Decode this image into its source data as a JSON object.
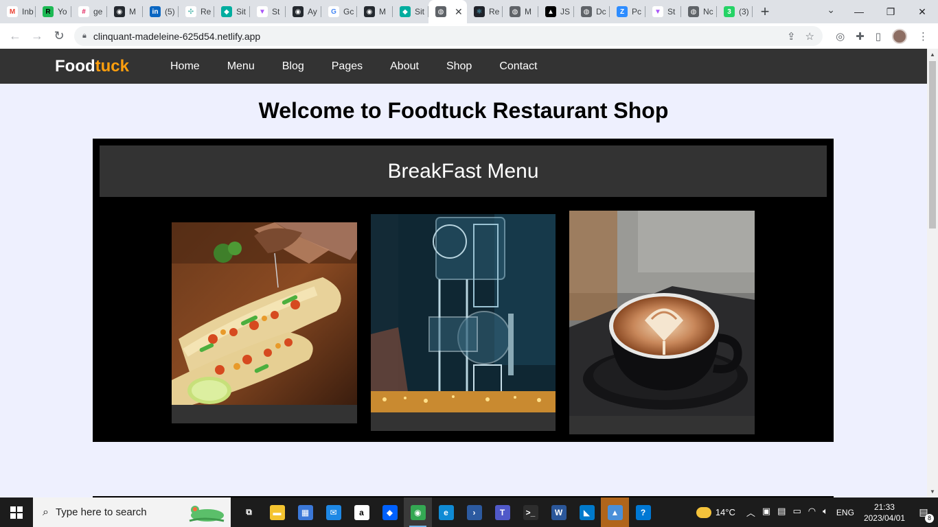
{
  "browser": {
    "tabs": [
      {
        "label": "Inb",
        "color": "#ffffff",
        "glyph": "M",
        "glyph_color": "#ea4335"
      },
      {
        "label": "Yo",
        "color": "#1db954",
        "glyph": "R",
        "glyph_color": "#000000"
      },
      {
        "label": "ge",
        "color": "#ffffff",
        "glyph": "#",
        "glyph_color": "#e01e5a"
      },
      {
        "label": "M",
        "color": "#24292f",
        "glyph": "◉",
        "glyph_color": "#ffffff"
      },
      {
        "label": "(5)",
        "color": "#0a66c2",
        "glyph": "in",
        "glyph_color": "#ffffff"
      },
      {
        "label": "Re",
        "color": "#ffffff",
        "glyph": "✣",
        "glyph_color": "#4db6ac"
      },
      {
        "label": "Sit",
        "color": "#00ad9f",
        "glyph": "◆",
        "glyph_color": "#ffffff"
      },
      {
        "label": "St",
        "color": "#ffffff",
        "glyph": "▼",
        "glyph_color": "#a855f7"
      },
      {
        "label": "Ay",
        "color": "#24292f",
        "glyph": "◉",
        "glyph_color": "#ffffff"
      },
      {
        "label": "Gc",
        "color": "#ffffff",
        "glyph": "G",
        "glyph_color": "#4285f4"
      },
      {
        "label": "M",
        "color": "#24292f",
        "glyph": "◉",
        "glyph_color": "#ffffff"
      },
      {
        "label": "Sit",
        "color": "#00ad9f",
        "glyph": "◆",
        "glyph_color": "#ffffff"
      },
      {
        "label": "Re",
        "color": "#20232a",
        "glyph": "⚛",
        "glyph_color": "#61dafb"
      },
      {
        "label": "M",
        "color": "#5f6368",
        "glyph": "◍",
        "glyph_color": "#ffffff"
      },
      {
        "label": "JS",
        "color": "#000000",
        "glyph": "▲",
        "glyph_color": "#ffffff"
      },
      {
        "label": "Dc",
        "color": "#5f6368",
        "glyph": "◍",
        "glyph_color": "#ffffff"
      },
      {
        "label": "Pc",
        "color": "#2d8cff",
        "glyph": "Z",
        "glyph_color": "#ffffff"
      },
      {
        "label": "St",
        "color": "#ffffff",
        "glyph": "▼",
        "glyph_color": "#a855f7"
      },
      {
        "label": "Nc",
        "color": "#5f6368",
        "glyph": "◍",
        "glyph_color": "#ffffff"
      },
      {
        "label": "(3)",
        "color": "#25d366",
        "glyph": "3",
        "glyph_color": "#ffffff"
      }
    ],
    "active_tab_close": "✕",
    "new_tab": "+",
    "url": "clinquant-madeleine-625d54.netlify.app"
  },
  "site": {
    "logo_main": "Food",
    "logo_accent": "tuck",
    "nav": [
      "Home",
      "Menu",
      "Blog",
      "Pages",
      "About",
      "Shop",
      "Contact"
    ],
    "page_title": "Welcome to Foodtuck Restaurant Shop",
    "section_title": "BreakFast Menu",
    "cards": [
      {
        "alt": "Tacos"
      },
      {
        "alt": "Syphon coffee brewer"
      },
      {
        "alt": "Latte art coffee"
      }
    ]
  },
  "taskbar": {
    "search_placeholder": "Type here to search",
    "apps": [
      {
        "name": "task-view",
        "glyph": "⧉",
        "bg": "#1c1c1c"
      },
      {
        "name": "file-explorer",
        "glyph": "▬",
        "bg": "#f4c430"
      },
      {
        "name": "ms-store",
        "glyph": "▦",
        "bg": "#3b78d8"
      },
      {
        "name": "mail",
        "glyph": "✉",
        "bg": "#1e88e5"
      },
      {
        "name": "amazon",
        "glyph": "a",
        "bg": "#ffffff"
      },
      {
        "name": "dropbox",
        "glyph": "◆",
        "bg": "#0061ff"
      },
      {
        "name": "chrome",
        "glyph": "◉",
        "bg": "#34a853"
      },
      {
        "name": "edge",
        "glyph": "e",
        "bg": "#0f8bd5"
      },
      {
        "name": "powershell",
        "glyph": "›",
        "bg": "#2c5aa0"
      },
      {
        "name": "teams",
        "glyph": "T",
        "bg": "#5059c9"
      },
      {
        "name": "terminal",
        "glyph": ">_",
        "bg": "#2d2d2d"
      },
      {
        "name": "word",
        "glyph": "W",
        "bg": "#2b579a"
      },
      {
        "name": "vscode",
        "glyph": "◣",
        "bg": "#007acc"
      },
      {
        "name": "photos",
        "glyph": "▲",
        "bg": "#4a90d9"
      },
      {
        "name": "help",
        "glyph": "?",
        "bg": "#0078d4"
      }
    ],
    "weather": "14°C",
    "language": "ENG",
    "time": "21:33",
    "date": "2023/04/01",
    "notifications": "8"
  }
}
